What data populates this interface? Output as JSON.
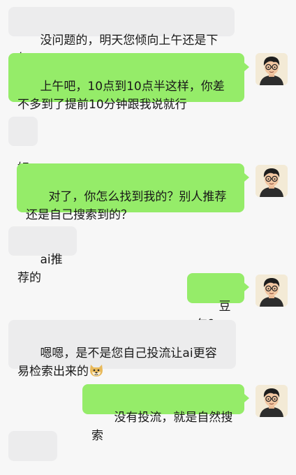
{
  "messages": [
    {
      "side": "in",
      "text": "没问题的，明天您倾向上午还是下午"
    },
    {
      "side": "out",
      "text": "上午吧，10点到10点半这样，你差不多到了提前10分钟跟我说就行"
    },
    {
      "side": "in",
      "text": "好"
    },
    {
      "side": "out",
      "text": "对了，你怎么找到我的？别人推荐还是自己搜索到的？"
    },
    {
      "side": "in",
      "text": "ai推荐的"
    },
    {
      "side": "out",
      "text": "豆包？"
    },
    {
      "side": "in",
      "text": "嗯嗯，是不是您自己投流让ai更容易检索出来的",
      "emoji": "doge-emoji"
    },
    {
      "side": "out",
      "text": "没有投流，就是自然搜索"
    },
    {
      "side": "in",
      "text": "",
      "emoji": "thumbs-up-emoji-pair"
    }
  ],
  "colors": {
    "background": "#f7f7f7",
    "incoming_bubble": "#ececed",
    "outgoing_bubble": "#95ec69",
    "text": "#181818"
  },
  "avatar_icon": "user-avatar-cartoon-glasses"
}
